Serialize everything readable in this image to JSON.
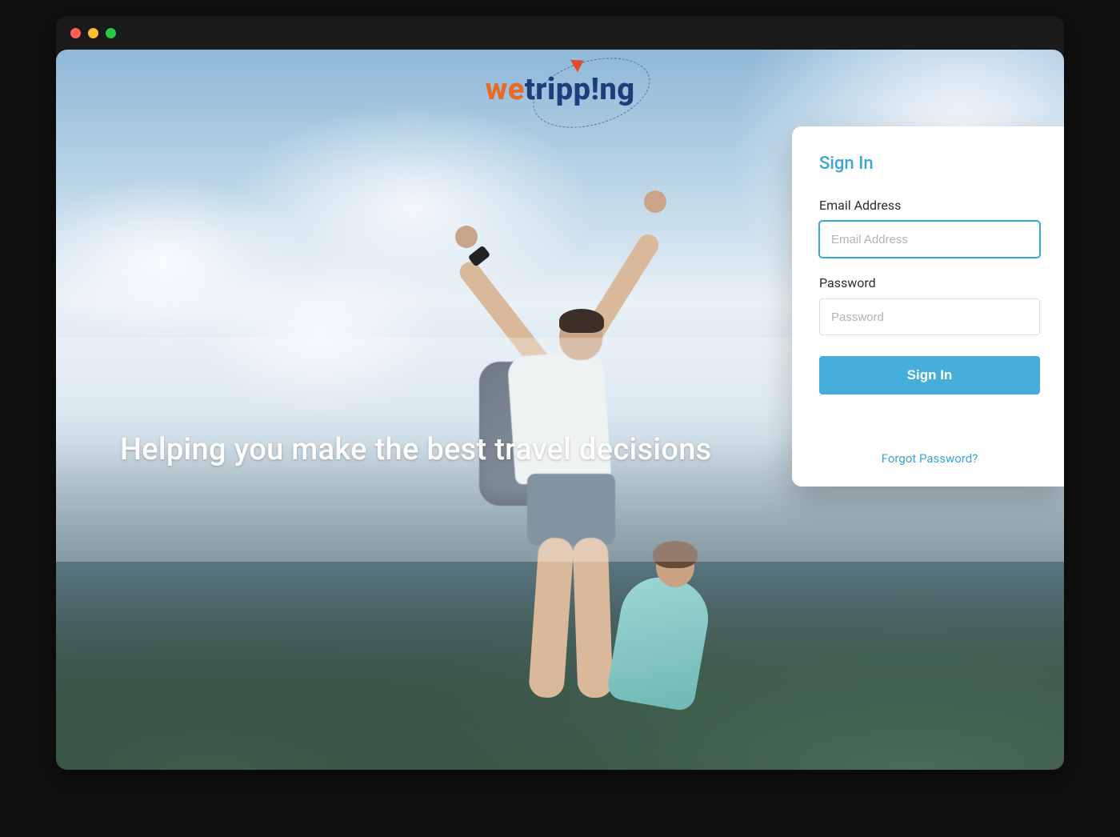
{
  "logo": {
    "part1": "we",
    "part2": "tripp!ng"
  },
  "hero": {
    "tagline": "Helping you make the best travel decisions"
  },
  "signin": {
    "title": "Sign In",
    "email_label": "Email Address",
    "email_placeholder": "Email Address",
    "password_label": "Password",
    "password_placeholder": "Password",
    "submit_label": "Sign In",
    "forgot_label": "Forgot Password?"
  },
  "colors": {
    "accent": "#3aa6d4",
    "brand_orange": "#e86a2b",
    "brand_navy": "#1c3f7c",
    "button": "#45aedb"
  }
}
